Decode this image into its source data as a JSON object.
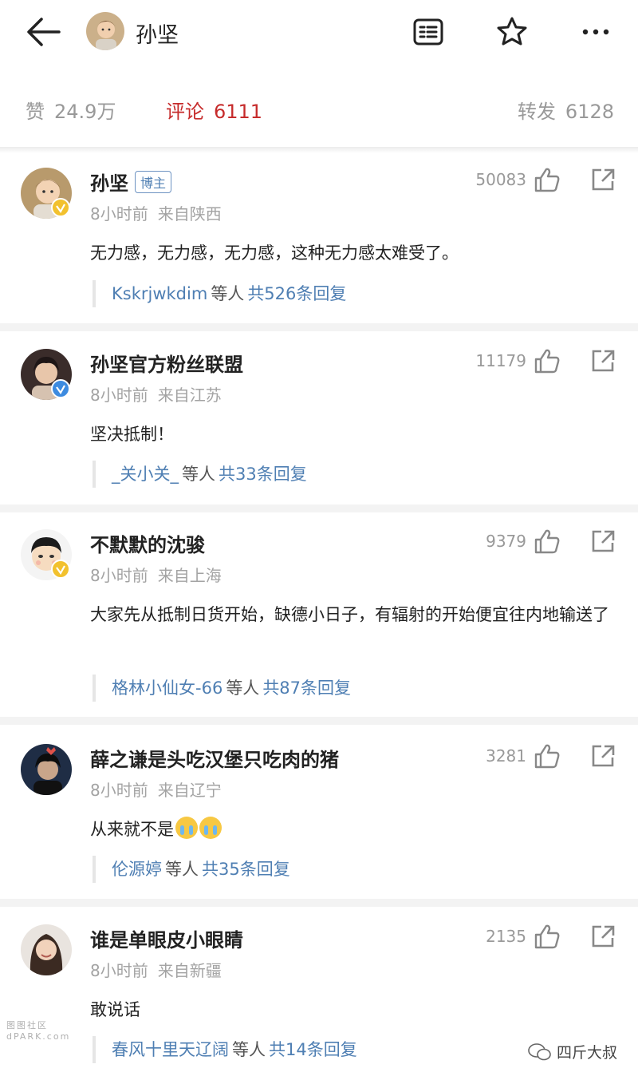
{
  "header": {
    "title": "孙坚"
  },
  "stats": {
    "like_label": "赞",
    "like_value": "24.9万",
    "comment_label": "评论",
    "comment_value": "6111",
    "repost_label": "转发",
    "repost_value": "6128"
  },
  "comments": [
    {
      "name": "孙坚",
      "badge": "博主",
      "likes": "50083",
      "time": "8小时前",
      "location": "来自陕西",
      "text": "无力感，无力感，无力感，这种无力感太难受了。",
      "reply_user": "Kskrjwkdim",
      "reply_mid": "等人",
      "reply_count": "共526条回复",
      "badge_color": "#f2c12e"
    },
    {
      "name": "孙坚官方粉丝联盟",
      "likes": "11179",
      "time": "8小时前",
      "location": "来自江苏",
      "text": "坚决抵制！",
      "reply_user": "_关小关_",
      "reply_mid": "等人",
      "reply_count": "共33条回复",
      "badge_color": "#3d8be0"
    },
    {
      "name": "不默默的沈骏",
      "likes": "9379",
      "time": "8小时前",
      "location": "来自上海",
      "text": "大家先从抵制日货开始，缺德小日子，有辐射的开始便宜往内地输送了",
      "reply_user": "格林小仙女-66",
      "reply_mid": "等人",
      "reply_count": "共87条回复",
      "badge_color": "#f2c12e"
    },
    {
      "name": "薛之谦是头吃汉堡只吃肉的猪",
      "likes": "3281",
      "time": "8小时前",
      "location": "来自辽宁",
      "text": "从来就不是",
      "reply_user": "伦源婷",
      "reply_mid": "等人",
      "reply_count": "共35条回复"
    },
    {
      "name": "谁是单眼皮小眼睛",
      "likes": "2135",
      "time": "8小时前",
      "location": "来自新疆",
      "text": "敢说话",
      "reply_user": "春风十里天辽阔",
      "reply_mid": "等人",
      "reply_count": "共14条回复"
    }
  ],
  "watermark": {
    "left": "图图社区",
    "left_sub": "dPARK.com",
    "right": "四斤大叔"
  },
  "colors": {
    "link": "#4f7fb3",
    "active_tab": "#c62b2b",
    "muted": "#999999"
  }
}
